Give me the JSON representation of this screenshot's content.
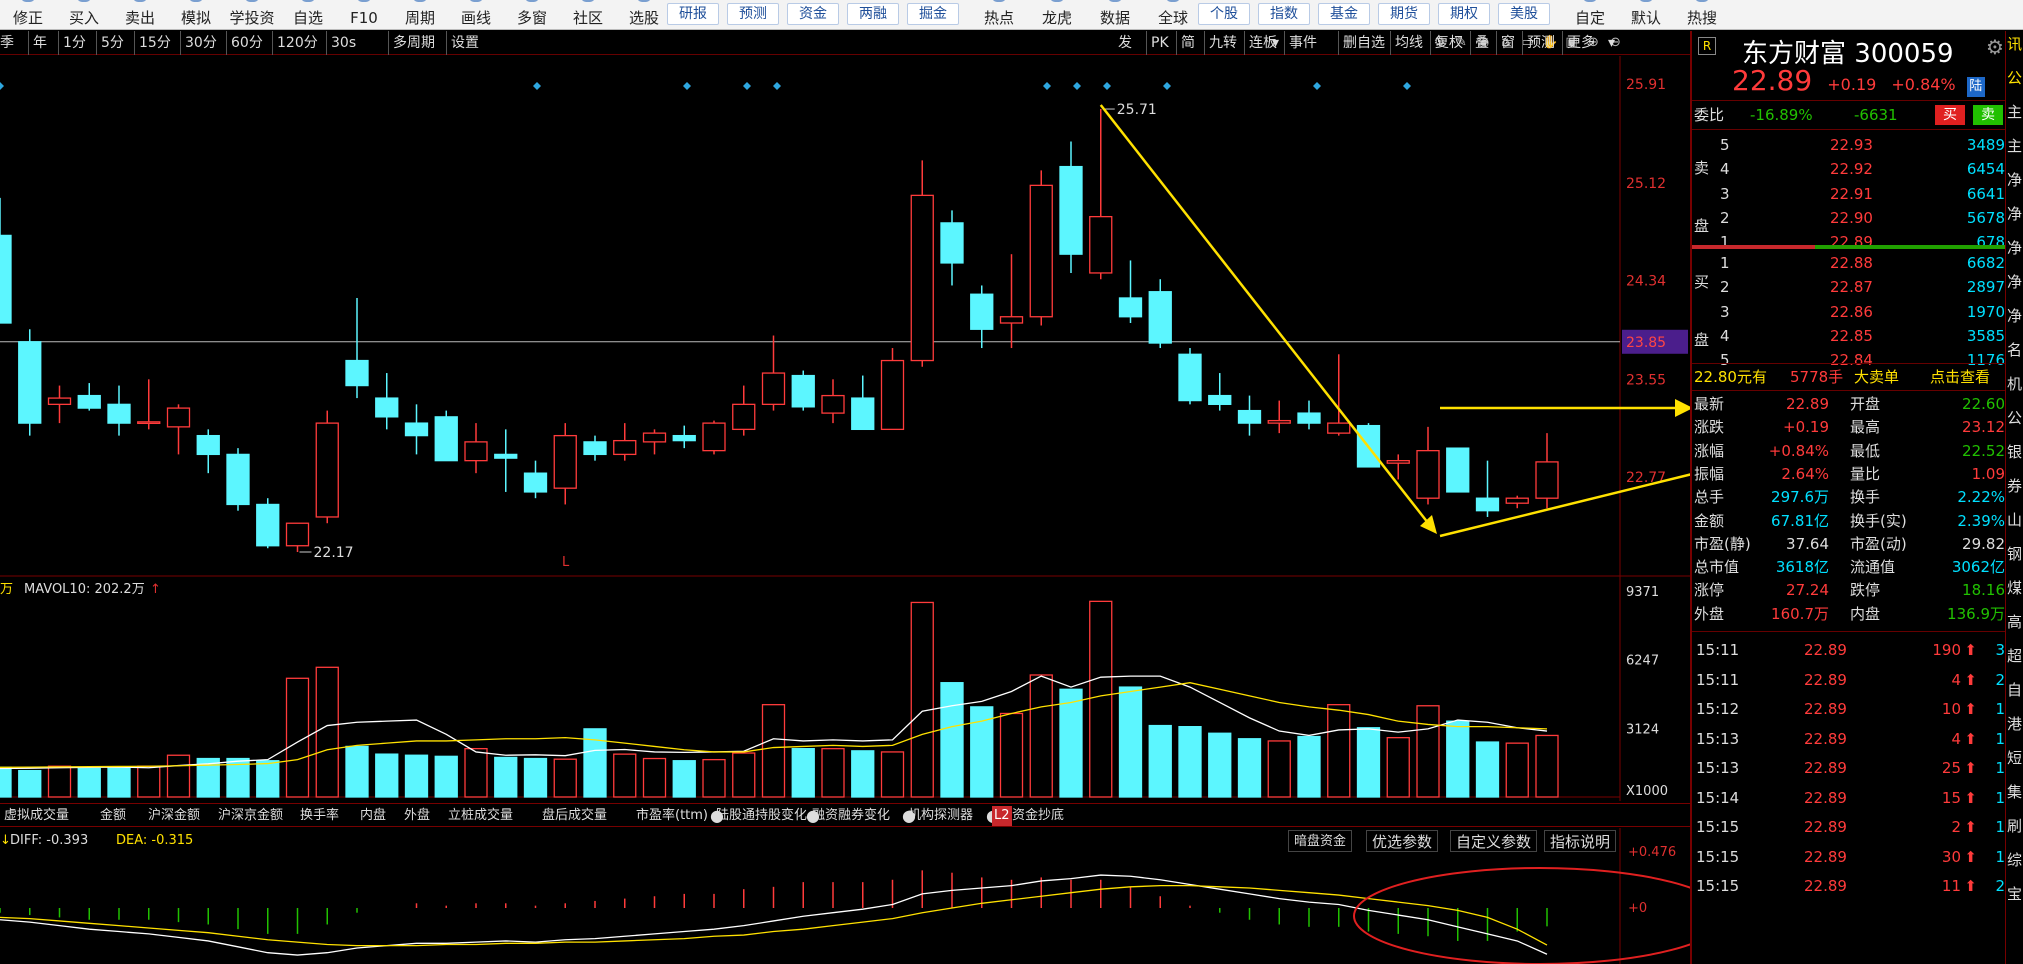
{
  "colors": {
    "up": "#ff3b3b",
    "down": "#5cf6ff",
    "ma5": "#ffffff",
    "ma10": "#ffe100",
    "accent": "#1f4f9a",
    "annotation": "#ffe100",
    "circle": "#e02020"
  },
  "toolbar": {
    "items": [
      "修正",
      "买入",
      "卖出",
      "模拟",
      "学投资",
      "自选",
      "F10",
      "周期",
      "画线",
      "多窗",
      "社区",
      "选股"
    ],
    "buttons": [
      "研报",
      "预测",
      "资金",
      "两融",
      "掘金"
    ],
    "items2": [
      "热点",
      "龙虎",
      "数据",
      "全球"
    ],
    "buttons2": [
      "个股",
      "指数",
      "基金",
      "期货",
      "期权",
      "美股"
    ],
    "items3": [
      "自定",
      "默认",
      "热搜"
    ]
  },
  "periods": [
    "季",
    "年",
    "1分",
    "5分",
    "15分",
    "30分",
    "60分",
    "120分",
    "30s",
    "多周期",
    "设置"
  ],
  "period_tools": [
    "发",
    "PK",
    "简",
    "九转",
    "连板",
    "事件",
    "删自选",
    "均线",
    "复权",
    "叠",
    "窗",
    "预测",
    "更多"
  ],
  "price_axis": [
    "25.91",
    "25.12",
    "24.34",
    "23.85",
    "23.55",
    "22.77"
  ],
  "current_price_tag": "23.85",
  "high_label": "25.71",
  "low_label": "22.17",
  "l_marker": "L",
  "volume": {
    "legend_unit": "万",
    "legend": "MAVOL10: 202.2万",
    "axis": [
      "9371",
      "6247",
      "3124",
      "X1000"
    ]
  },
  "indicator_tabs": [
    "虚拟成交量",
    "金额",
    "沪深金额",
    "沪深京金额",
    "换手率",
    "内盘",
    "外盘",
    "立桩成交量",
    "盘后成交量",
    "市盈率(ttm)",
    "陆股通持股变化",
    "融资融券变化",
    "机构探测器",
    "L2",
    "资金抄底"
  ],
  "macd": {
    "diff": "DIFF: -0.393",
    "dea": "DEA: -0.315",
    "axis_top": "+0.476",
    "axis_zero": "+0",
    "buttons": [
      "暗盘资金",
      "优选参数",
      "自定义参数",
      "指标说明"
    ]
  },
  "stock": {
    "name": "东方财富",
    "code": "300059",
    "price": "22.89",
    "change": "+0.19",
    "change_pct": "+0.84%",
    "flag": "陆",
    "r_badge": "R",
    "weibi_label": "委比",
    "weibi": "-16.89%",
    "weicha": "-6631",
    "buy_btn": "买",
    "sell_btn": "卖",
    "ask_label": [
      "卖",
      "盘"
    ],
    "bid_label": [
      "买",
      "盘"
    ],
    "asks": [
      {
        "lvl": "5",
        "price": "22.93",
        "vol": "3489"
      },
      {
        "lvl": "4",
        "price": "22.92",
        "vol": "6454"
      },
      {
        "lvl": "3",
        "price": "22.91",
        "vol": "6641"
      },
      {
        "lvl": "2",
        "price": "22.90",
        "vol": "5678"
      },
      {
        "lvl": "1",
        "price": "22.89",
        "vol": "678"
      }
    ],
    "bids": [
      {
        "lvl": "1",
        "price": "22.88",
        "vol": "6682"
      },
      {
        "lvl": "2",
        "price": "22.87",
        "vol": "2897"
      },
      {
        "lvl": "3",
        "price": "22.86",
        "vol": "1970"
      },
      {
        "lvl": "4",
        "price": "22.85",
        "vol": "3585"
      },
      {
        "lvl": "5",
        "price": "22.84",
        "vol": "1176"
      }
    ],
    "big_order": {
      "price_text": "22.80元有",
      "qty": "5778手",
      "label": "大卖单",
      "link": "点击查看"
    },
    "stats": [
      {
        "l1": "最新",
        "v1": "22.89",
        "c1": "red",
        "l2": "开盘",
        "v2": "22.60",
        "c2": "green"
      },
      {
        "l1": "涨跌",
        "v1": "+0.19",
        "c1": "red",
        "l2": "最高",
        "v2": "23.12",
        "c2": "red"
      },
      {
        "l1": "涨幅",
        "v1": "+0.84%",
        "c1": "red",
        "l2": "最低",
        "v2": "22.52",
        "c2": "green"
      },
      {
        "l1": "振幅",
        "v1": "2.64%",
        "c1": "red",
        "l2": "量比",
        "v2": "1.09",
        "c2": "red"
      },
      {
        "l1": "总手",
        "v1": "297.6万",
        "c1": "cyan",
        "l2": "换手",
        "v2": "2.22%",
        "c2": "cyan"
      },
      {
        "l1": "金额",
        "v1": "67.81亿",
        "c1": "cyan",
        "l2": "换手(实)",
        "v2": "2.39%",
        "c2": "cyan"
      },
      {
        "l1": "市盈(静)",
        "v1": "37.64",
        "c1": "white",
        "l2": "市盈(动)",
        "v2": "29.82",
        "c2": "white"
      },
      {
        "l1": "总市值",
        "v1": "3618亿",
        "c1": "cyan",
        "l2": "流通值",
        "v2": "3062亿",
        "c2": "cyan"
      },
      {
        "l1": "涨停",
        "v1": "27.24",
        "c1": "red",
        "l2": "跌停",
        "v2": "18.16",
        "c2": "green"
      },
      {
        "l1": "外盘",
        "v1": "160.7万",
        "c1": "red",
        "l2": "内盘",
        "v2": "136.9万",
        "c2": "green"
      }
    ],
    "ticks": [
      {
        "time": "15:11",
        "price": "22.89",
        "vol": "190",
        "tail": "3"
      },
      {
        "time": "15:11",
        "price": "22.89",
        "vol": "4",
        "tail": "2"
      },
      {
        "time": "15:12",
        "price": "22.89",
        "vol": "10",
        "tail": "1"
      },
      {
        "time": "15:13",
        "price": "22.89",
        "vol": "4",
        "tail": "1"
      },
      {
        "time": "15:13",
        "price": "22.89",
        "vol": "25",
        "tail": "1"
      },
      {
        "time": "15:14",
        "price": "22.89",
        "vol": "15",
        "tail": "1"
      },
      {
        "time": "15:15",
        "price": "22.89",
        "vol": "2",
        "tail": "1"
      },
      {
        "time": "15:15",
        "price": "22.89",
        "vol": "30",
        "tail": "1"
      },
      {
        "time": "15:15",
        "price": "22.89",
        "vol": "11",
        "tail": "2"
      }
    ]
  },
  "far_right_chars": [
    "讯",
    "公",
    "主",
    "主",
    "净",
    "净",
    "净",
    "净",
    "净",
    "名",
    "机",
    "公",
    "银",
    "券",
    "山",
    "钢",
    "煤",
    "高",
    "超",
    "自",
    "港",
    "短",
    "集",
    "刷",
    "综",
    "宝"
  ],
  "chart_data": {
    "type": "candlestick",
    "candles": [
      {
        "o": 24.7,
        "h": 25.0,
        "l": 24.0,
        "c": 24.0
      },
      {
        "o": 23.85,
        "h": 23.95,
        "l": 23.1,
        "c": 23.2
      },
      {
        "o": 23.35,
        "h": 23.5,
        "l": 23.2,
        "c": 23.4
      },
      {
        "o": 23.42,
        "h": 23.52,
        "l": 23.3,
        "c": 23.32
      },
      {
        "o": 23.35,
        "h": 23.5,
        "l": 23.1,
        "c": 23.2
      },
      {
        "o": 23.2,
        "h": 23.55,
        "l": 23.15,
        "c": 23.21
      },
      {
        "o": 23.17,
        "h": 23.35,
        "l": 22.95,
        "c": 23.32
      },
      {
        "o": 23.1,
        "h": 23.15,
        "l": 22.8,
        "c": 22.95
      },
      {
        "o": 22.95,
        "h": 23.0,
        "l": 22.5,
        "c": 22.55
      },
      {
        "o": 22.55,
        "h": 22.6,
        "l": 22.2,
        "c": 22.22
      },
      {
        "o": 22.22,
        "h": 22.4,
        "l": 22.17,
        "c": 22.4
      },
      {
        "o": 22.45,
        "h": 23.3,
        "l": 22.4,
        "c": 23.2
      },
      {
        "o": 23.7,
        "h": 24.2,
        "l": 23.4,
        "c": 23.5
      },
      {
        "o": 23.4,
        "h": 23.6,
        "l": 23.15,
        "c": 23.25
      },
      {
        "o": 23.2,
        "h": 23.35,
        "l": 22.95,
        "c": 23.1
      },
      {
        "o": 23.25,
        "h": 23.3,
        "l": 22.9,
        "c": 22.9
      },
      {
        "o": 22.9,
        "h": 23.2,
        "l": 22.8,
        "c": 23.05
      },
      {
        "o": 22.95,
        "h": 23.15,
        "l": 22.65,
        "c": 22.92
      },
      {
        "o": 22.8,
        "h": 22.9,
        "l": 22.6,
        "c": 22.65
      },
      {
        "o": 22.68,
        "h": 23.2,
        "l": 22.55,
        "c": 23.1
      },
      {
        "o": 23.05,
        "h": 23.1,
        "l": 22.9,
        "c": 22.95
      },
      {
        "o": 22.95,
        "h": 23.2,
        "l": 22.9,
        "c": 23.06
      },
      {
        "o": 23.05,
        "h": 23.15,
        "l": 22.95,
        "c": 23.12
      },
      {
        "o": 23.1,
        "h": 23.18,
        "l": 23.0,
        "c": 23.06
      },
      {
        "o": 22.98,
        "h": 23.22,
        "l": 22.95,
        "c": 23.2
      },
      {
        "o": 23.15,
        "h": 23.5,
        "l": 23.1,
        "c": 23.35
      },
      {
        "o": 23.35,
        "h": 23.9,
        "l": 23.3,
        "c": 23.6
      },
      {
        "o": 23.58,
        "h": 23.62,
        "l": 23.3,
        "c": 23.33
      },
      {
        "o": 23.28,
        "h": 23.55,
        "l": 23.2,
        "c": 23.42
      },
      {
        "o": 23.4,
        "h": 23.58,
        "l": 23.15,
        "c": 23.15
      },
      {
        "o": 23.15,
        "h": 23.8,
        "l": 23.15,
        "c": 23.7
      },
      {
        "o": 23.7,
        "h": 25.3,
        "l": 23.65,
        "c": 25.02
      },
      {
        "o": 24.8,
        "h": 24.9,
        "l": 24.3,
        "c": 24.48
      },
      {
        "o": 24.23,
        "h": 24.3,
        "l": 23.8,
        "c": 23.95
      },
      {
        "o": 24.0,
        "h": 24.55,
        "l": 23.8,
        "c": 24.05
      },
      {
        "o": 24.05,
        "h": 25.22,
        "l": 23.98,
        "c": 25.1
      },
      {
        "o": 25.25,
        "h": 25.45,
        "l": 24.4,
        "c": 24.55
      },
      {
        "o": 24.4,
        "h": 25.71,
        "l": 24.35,
        "c": 24.85
      },
      {
        "o": 24.2,
        "h": 24.5,
        "l": 24.0,
        "c": 24.05
      },
      {
        "o": 24.25,
        "h": 24.35,
        "l": 23.8,
        "c": 23.84
      },
      {
        "o": 23.75,
        "h": 23.8,
        "l": 23.35,
        "c": 23.38
      },
      {
        "o": 23.42,
        "h": 23.6,
        "l": 23.3,
        "c": 23.35
      },
      {
        "o": 23.3,
        "h": 23.42,
        "l": 23.1,
        "c": 23.2
      },
      {
        "o": 23.2,
        "h": 23.38,
        "l": 23.12,
        "c": 23.22
      },
      {
        "o": 23.28,
        "h": 23.38,
        "l": 23.15,
        "c": 23.2
      },
      {
        "o": 23.12,
        "h": 23.75,
        "l": 23.1,
        "c": 23.2
      },
      {
        "o": 23.18,
        "h": 23.2,
        "l": 22.85,
        "c": 22.85
      },
      {
        "o": 22.88,
        "h": 22.95,
        "l": 22.75,
        "c": 22.9
      },
      {
        "o": 22.6,
        "h": 23.17,
        "l": 22.55,
        "c": 22.98
      },
      {
        "o": 23.0,
        "h": 23.0,
        "l": 22.65,
        "c": 22.65
      },
      {
        "o": 22.6,
        "h": 22.9,
        "l": 22.45,
        "c": 22.5
      },
      {
        "o": 22.56,
        "h": 22.62,
        "l": 22.52,
        "c": 22.6
      },
      {
        "o": 22.6,
        "h": 23.12,
        "l": 22.52,
        "c": 22.89
      }
    ],
    "volume_thousands": [
      1350,
      1200,
      1400,
      1300,
      1320,
      1400,
      1900,
      1750,
      1750,
      1650,
      5400,
      5900,
      2300,
      1950,
      1900,
      1850,
      2200,
      1800,
      1750,
      1720,
      3100,
      1950,
      1750,
      1650,
      1700,
      2000,
      4200,
      2200,
      2200,
      2100,
      2050,
      8850,
      5200,
      4100,
      3800,
      5550,
      4900,
      8900,
      5000,
      3250,
      3200,
      2900,
      2650,
      2550,
      2750,
      4200,
      3150,
      2700,
      4150,
      3450,
      2500,
      2450,
      2800
    ],
    "ma5_thousands": [
      1300,
      1310,
      1330,
      1350,
      1360,
      1330,
      1430,
      1510,
      1630,
      1700,
      2500,
      3250,
      3400,
      3450,
      3500,
      2850,
      2050,
      1900,
      1920,
      1880,
      2120,
      2160,
      2050,
      2030,
      2050,
      2080,
      2650,
      2550,
      2600,
      2550,
      2600,
      3900,
      4150,
      4350,
      4800,
      5500,
      5000,
      5450,
      5500,
      5500,
      5000,
      4300,
      3600,
      3000,
      2800,
      3050,
      3100,
      2950,
      3100,
      3500,
      3400,
      3150,
      3000
    ],
    "ma10_thousands": [
      1350,
      1360,
      1370,
      1380,
      1390,
      1400,
      1420,
      1450,
      1480,
      1520,
      1700,
      2150,
      2350,
      2450,
      2550,
      2550,
      2600,
      2650,
      2650,
      2700,
      2600,
      2450,
      2300,
      2150,
      2050,
      2050,
      2250,
      2300,
      2350,
      2300,
      2350,
      2850,
      3200,
      3450,
      3800,
      4100,
      4300,
      4600,
      4800,
      5000,
      5200,
      4900,
      4600,
      4300,
      4100,
      3950,
      3750,
      3450,
      3300,
      3200,
      3200,
      3150,
      3100
    ],
    "macd_diff": [
      -0.1,
      -0.12,
      -0.15,
      -0.18,
      -0.2,
      -0.22,
      -0.25,
      -0.28,
      -0.33,
      -0.38,
      -0.4,
      -0.38,
      -0.34,
      -0.32,
      -0.3,
      -0.3,
      -0.29,
      -0.28,
      -0.29,
      -0.27,
      -0.26,
      -0.24,
      -0.22,
      -0.2,
      -0.18,
      -0.15,
      -0.11,
      -0.07,
      -0.04,
      -0.01,
      0.03,
      0.12,
      0.15,
      0.17,
      0.19,
      0.23,
      0.25,
      0.28,
      0.27,
      0.24,
      0.2,
      0.16,
      0.12,
      0.08,
      0.05,
      0.03,
      -0.02,
      -0.06,
      -0.1,
      -0.16,
      -0.22,
      -0.28,
      -0.393
    ],
    "macd_dea": [
      -0.08,
      -0.09,
      -0.11,
      -0.13,
      -0.15,
      -0.17,
      -0.19,
      -0.21,
      -0.24,
      -0.27,
      -0.29,
      -0.31,
      -0.32,
      -0.32,
      -0.32,
      -0.31,
      -0.31,
      -0.3,
      -0.3,
      -0.29,
      -0.29,
      -0.28,
      -0.27,
      -0.26,
      -0.24,
      -0.23,
      -0.2,
      -0.18,
      -0.15,
      -0.12,
      -0.09,
      -0.04,
      0.0,
      0.04,
      0.07,
      0.1,
      0.13,
      0.16,
      0.18,
      0.19,
      0.19,
      0.18,
      0.17,
      0.15,
      0.13,
      0.11,
      0.08,
      0.05,
      0.02,
      -0.02,
      -0.08,
      -0.18,
      -0.315
    ],
    "ylim_price": [
      22.17,
      25.91
    ],
    "ylim_volume_thousands": [
      0,
      9371
    ],
    "ylim_macd": [
      -0.5,
      0.476
    ]
  }
}
